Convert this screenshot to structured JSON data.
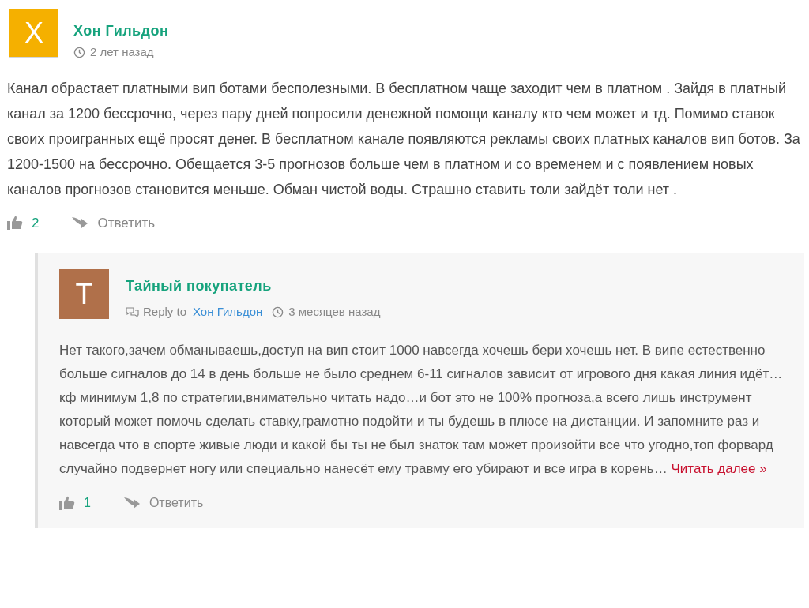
{
  "comment": {
    "avatar_letter": "Х",
    "color": "#f5b000",
    "author": "Хон Гильдон",
    "time": "2 лет назад",
    "text": "Канал обрастает платными вип ботами бесполезными. В бесплатном чаще заходит чем в платном . Зайдя в платный канал за 1200 бессрочно, через пару дней попросили денежной помощи каналу кто чем может и тд. Помимо ставок своих проигранных ещё просят денег. В бесплатном канале появляются рекламы своих платных каналов вип ботов. За 1200-1500 на бессрочно. Обещается 3-5 прогнозов больше чем в платном и со временем и с появлением новых каналов прогнозов становится меньше. Обман чистой воды. Страшно ставить толи зайдёт толи нет .",
    "likes": "2",
    "reply_label": "Ответить"
  },
  "reply": {
    "avatar_letter": "Т",
    "color": "#b0704a",
    "author": "Тайный покупатель",
    "reply_to_label": "Reply to",
    "reply_to": "Хон Гильдон",
    "time": "3 месяцев назад",
    "text": "Нет такого,зачем обманываешь,доступ на вип стоит 1000 навсегда хочешь бери хочешь нет. В випе естественно больше сигналов до 14 в день больше не было среднем 6-11 сигналов зависит от игрового дня какая линия идёт…кф минимум 1,8 по стратегии,внимательно читать надо…и бот это не 100% прогноза,а всего лишь инструмент который может помочь сделать ставку,грамотно подойти и ты будешь в плюсе на дистанции. И запомните раз и навсегда что в спорте живые люди и какой бы ты не был знаток там может произойти все что угодно,топ форвард случайно подвернет ногу или специально нанесёт ему травму его убирают и все игра в корень…",
    "read_more": "Читать далее »",
    "likes": "1",
    "reply_label": "Ответить"
  }
}
